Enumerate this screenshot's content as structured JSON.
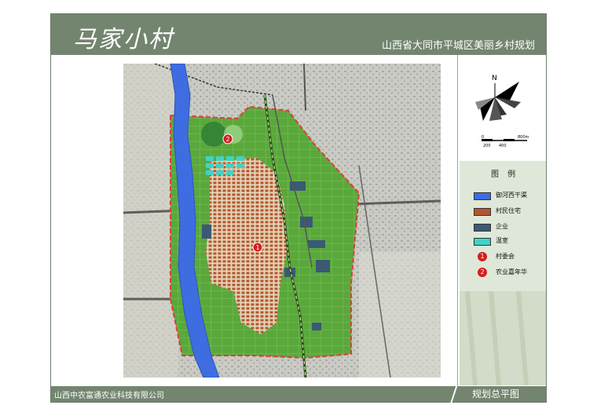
{
  "header": {
    "logo_text": "马家小村",
    "title": "山西省大同市平城区美丽乡村规划"
  },
  "footer": {
    "company": "山西中农富通农业科技有限公司",
    "drawing_name": "规划总平图"
  },
  "compass": {
    "north": "N",
    "scale_labels": [
      "0",
      "200",
      "400",
      "800m"
    ]
  },
  "legend": {
    "title": "图 例",
    "items": [
      {
        "label": "御河西干渠",
        "color": "#3d6de0",
        "kind": "swatch"
      },
      {
        "label": "村民住宅",
        "color": "#b5552f",
        "kind": "swatch"
      },
      {
        "label": "企业",
        "color": "#3a5a74",
        "kind": "swatch"
      },
      {
        "label": "温室",
        "color": "#3fd3c6",
        "kind": "swatch"
      },
      {
        "label": "村委会",
        "color": "#d21f1f",
        "kind": "marker",
        "number": "1"
      },
      {
        "label": "农业嘉年华",
        "color": "#d21f1f",
        "kind": "marker",
        "number": "2"
      }
    ]
  },
  "map": {
    "markers": [
      {
        "number": "1",
        "name": "村委会"
      },
      {
        "number": "2",
        "name": "农业嘉年华"
      }
    ]
  },
  "colors": {
    "frame": "#73856f",
    "farmland": "#57a53a",
    "river": "#3d6de0",
    "boundary": "#e23b3b"
  }
}
